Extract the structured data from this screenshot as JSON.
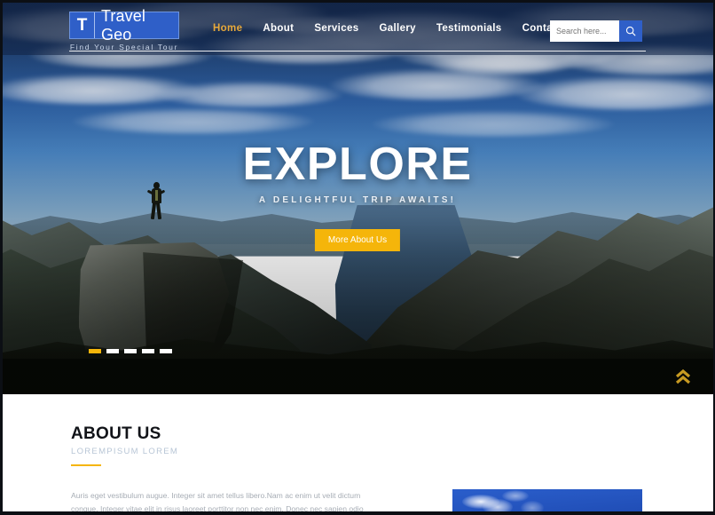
{
  "site": {
    "logo_initial": "T",
    "logo_name": "Travel Geo",
    "tagline": "Find Your Special Tour",
    "brand_blue": "#2f5fc8",
    "accent_gold": "#f5b50a"
  },
  "nav": {
    "items": [
      {
        "label": "Home",
        "active": true
      },
      {
        "label": "About",
        "active": false
      },
      {
        "label": "Services",
        "active": false
      },
      {
        "label": "Gallery",
        "active": false
      },
      {
        "label": "Testimonials",
        "active": false
      },
      {
        "label": "Contact",
        "active": false
      }
    ]
  },
  "search": {
    "placeholder": "Search here...",
    "value": "",
    "icon": "search-icon"
  },
  "hero": {
    "title": "EXPLORE",
    "subtitle": "A DELIGHTFUL TRIP AWAITS!",
    "cta_label": "More About Us",
    "slides_total": 5,
    "slide_active": 1,
    "scroll_top_icon": "double-chevron-up-icon"
  },
  "about": {
    "title": "ABOUT US",
    "subtitle": "LOREMPISUM LOREM",
    "body": "Auris eget vestibulum augue. Integer sit amet tellus libero.Nam ac enim ut velit dictum congue. Integer vitae elit in risus laoreet porttitor non nec enim. Donec nec sapien odio"
  }
}
